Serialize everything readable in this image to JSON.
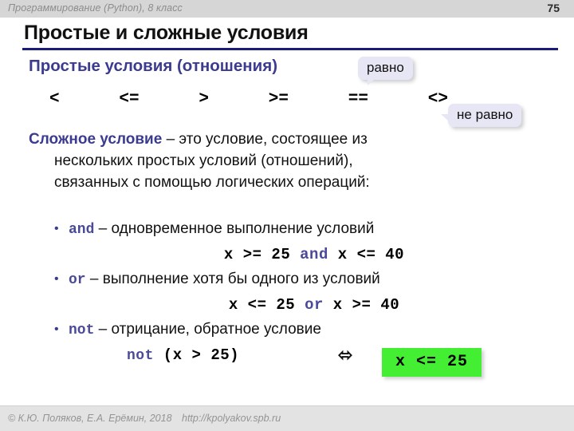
{
  "header": {
    "course": "Программирование (Python), 8 класс",
    "page_number": "75"
  },
  "title": "Простые и сложные условия",
  "subtitle": "Простые условия (отношения)",
  "operators": [
    {
      "symbol": "<"
    },
    {
      "symbol": "<="
    },
    {
      "symbol": ">"
    },
    {
      "symbol": ">="
    },
    {
      "symbol": "=="
    },
    {
      "symbol": "<>"
    }
  ],
  "callouts": {
    "equal": "равно",
    "not_equal": "не равно"
  },
  "definition": {
    "lead": "Сложное условие",
    "line1_rest": " – это условие, состоящее из",
    "line2": "нескольких простых условий (отношений),",
    "line3": "связанных с помощью логических операций:"
  },
  "bullets": [
    {
      "marker": "•",
      "keyword": "and",
      "text": " – одновременное выполнение условий",
      "code_pre": "x >= 25 ",
      "code_kw": "and",
      "code_post": " x <= 40"
    },
    {
      "marker": "•",
      "keyword": "or",
      "text": " – выполнение хотя бы одного из условий",
      "code_pre": "x <= 25 ",
      "code_kw": "or",
      "code_post": " x >= 40"
    },
    {
      "marker": "•",
      "keyword": "not",
      "text": " – отрицание, обратное условие"
    }
  ],
  "final": {
    "code_kw": "not",
    "code_rest": " (x > 25)",
    "equiv_symbol": "⬄",
    "result_box": "x <= 25",
    "result_box_color": "#44ee33"
  },
  "footer": {
    "copyright": "© К.Ю. Поляков, Е.А. Ерёмин, 2018",
    "url": "http://kpolyakov.spb.ru"
  },
  "colors": {
    "accent_blue": "#3b3b8f",
    "rule_blue": "#1b1b7a",
    "callout_bg": "#e6e6f5",
    "green": "#44ee33",
    "header_bg": "#d6d6d6",
    "footer_bg": "#e3e3e3"
  }
}
